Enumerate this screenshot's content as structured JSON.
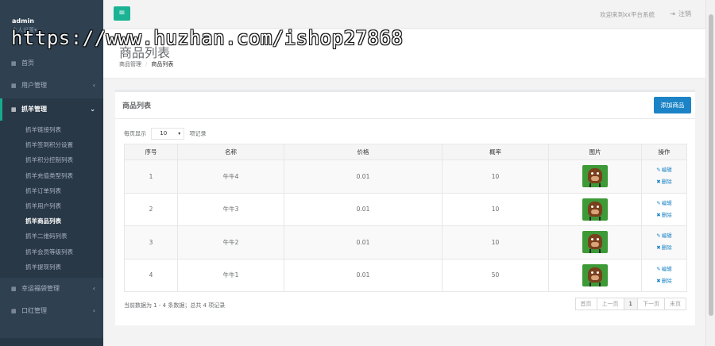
{
  "sidebar": {
    "user": "admin",
    "role": "个人设置▾",
    "items": [
      {
        "label": "首页",
        "icon": "grid-icon"
      },
      {
        "label": "用户管理",
        "icon": "grid-icon",
        "chevron": "‹"
      },
      {
        "label": "抓羊管理",
        "icon": "grid-icon",
        "chevron": "⌄"
      }
    ],
    "sub_items": [
      "抓羊链接列表",
      "抓羊签到积分设置",
      "抓羊积分控制列表",
      "抓羊充值类型列表",
      "抓羊订单列表",
      "抓羊用户列表",
      "抓羊商品列表",
      "抓羊二维码列表",
      "抓羊会员等级列表",
      "抓羊提现列表"
    ],
    "bottom_items": [
      {
        "label": "幸运福袋管理",
        "icon": "grid-icon",
        "chevron": "‹"
      },
      {
        "label": "口红管理",
        "icon": "grid-icon",
        "chevron": "‹"
      }
    ]
  },
  "topbar": {
    "menu_icon": "≡",
    "welcome": "欢迎来到xx平台系统",
    "logout": "注销",
    "logout_icon": "⇥"
  },
  "watermark": "https://www.huzhan.com/ishop27868",
  "page": {
    "title": "商品列表",
    "breadcrumb": [
      "商品管理",
      "商品列表"
    ]
  },
  "card": {
    "title": "商品列表",
    "add_button": "添加商品",
    "length_prefix": "每页显示",
    "length_value": "10",
    "length_suffix": "项记录",
    "columns": [
      "序号",
      "名称",
      "价格",
      "概率",
      "图片",
      "操作"
    ],
    "rows": [
      {
        "no": "1",
        "name": "牛牛4",
        "price": "0.01",
        "rate": "10"
      },
      {
        "no": "2",
        "name": "牛牛3",
        "price": "0.01",
        "rate": "10"
      },
      {
        "no": "3",
        "name": "牛牛2",
        "price": "0.01",
        "rate": "10"
      },
      {
        "no": "4",
        "name": "牛牛1",
        "price": "0.01",
        "rate": "50"
      }
    ],
    "edit_label": "编辑",
    "delete_label": "删除",
    "info": "当前数据为 1 - 4 条数据；总共 4 项记录",
    "pager": [
      "首页",
      "上一页",
      "1",
      "下一页",
      "末页"
    ]
  },
  "colors": {
    "sidebar": "#2f4050",
    "accent": "#1ab394",
    "primary": "#1c84c6"
  }
}
